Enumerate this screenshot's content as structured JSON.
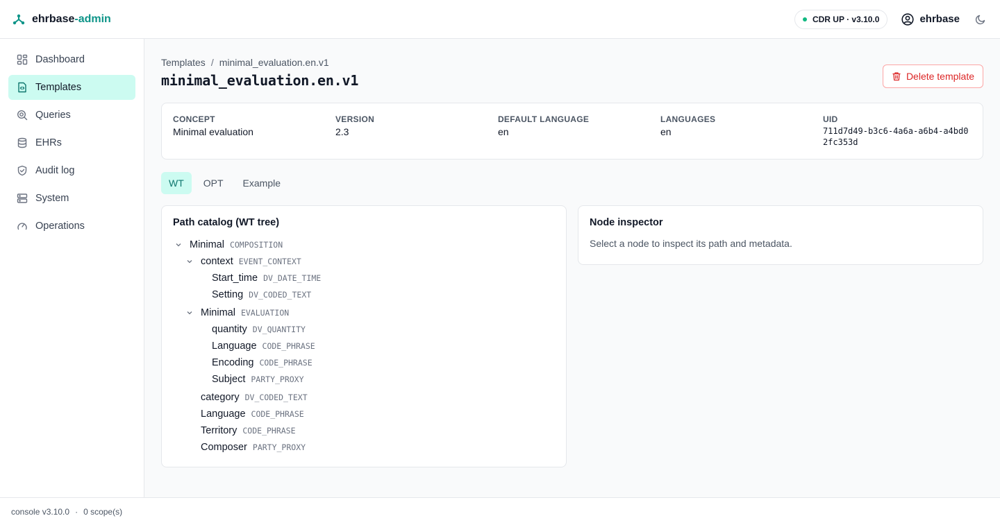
{
  "app": {
    "brand_main": "ehrbase",
    "brand_accent": "-admin",
    "accent_color": "#0d9488",
    "status": "CDR UP · v3.10.0",
    "user": "ehrbase"
  },
  "sidebar": {
    "items": [
      {
        "label": "Dashboard",
        "icon": "dashboard-icon"
      },
      {
        "label": "Templates",
        "icon": "template-icon",
        "active": true
      },
      {
        "label": "Queries",
        "icon": "search-icon"
      },
      {
        "label": "EHRs",
        "icon": "database-icon"
      },
      {
        "label": "Audit log",
        "icon": "shield-icon"
      },
      {
        "label": "System",
        "icon": "server-icon"
      },
      {
        "label": "Operations",
        "icon": "gauge-icon"
      }
    ]
  },
  "breadcrumb": {
    "root": "Templates",
    "separator": "/",
    "current": "minimal_evaluation.en.v1"
  },
  "page": {
    "title": "minimal_evaluation.en.v1",
    "delete_label": "Delete template"
  },
  "meta": {
    "concept_label": "CONCEPT",
    "concept": "Minimal evaluation",
    "version_label": "VERSION",
    "version": "2.3",
    "default_language_label": "DEFAULT LANGUAGE",
    "default_language": "en",
    "languages_label": "LANGUAGES",
    "languages": "en",
    "uid_label": "UID",
    "uid": "711d7d49-b3c6-4a6a-a6b4-a4bd02fc353d"
  },
  "tabs": [
    {
      "label": "WT",
      "active": true
    },
    {
      "label": "OPT"
    },
    {
      "label": "Example"
    }
  ],
  "tree": {
    "title": "Path catalog (WT tree)",
    "nodes": [
      {
        "name": "Minimal",
        "type": "COMPOSITION",
        "level": 0,
        "expanded": true
      },
      {
        "name": "context",
        "type": "EVENT_CONTEXT",
        "level": 1,
        "expanded": true
      },
      {
        "name": "Start_time",
        "type": "DV_DATE_TIME",
        "level": 2
      },
      {
        "name": "Setting",
        "type": "DV_CODED_TEXT",
        "level": 2
      },
      {
        "name": "Minimal",
        "type": "EVALUATION",
        "level": 1,
        "expanded": true
      },
      {
        "name": "quantity",
        "type": "DV_QUANTITY",
        "level": 2
      },
      {
        "name": "Language",
        "type": "CODE_PHRASE",
        "level": 2
      },
      {
        "name": "Encoding",
        "type": "CODE_PHRASE",
        "level": 2
      },
      {
        "name": "Subject",
        "type": "PARTY_PROXY",
        "level": 2
      },
      {
        "name": "category",
        "type": "DV_CODED_TEXT",
        "level": 1
      },
      {
        "name": "Language",
        "type": "CODE_PHRASE",
        "level": 1
      },
      {
        "name": "Territory",
        "type": "CODE_PHRASE",
        "level": 1
      },
      {
        "name": "Composer",
        "type": "PARTY_PROXY",
        "level": 1
      }
    ]
  },
  "inspector": {
    "title": "Node inspector",
    "hint": "Select a node to inspect its path and metadata."
  },
  "footer": {
    "version": "console v3.10.0",
    "dot": "·",
    "scopes": "0 scope(s)"
  }
}
